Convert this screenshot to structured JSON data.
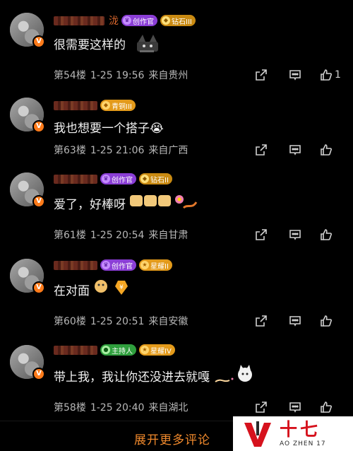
{
  "comments": [
    {
      "name_suffix": "泷",
      "badges": [
        {
          "label": "创作官",
          "icon": "creator-icon",
          "color": "#8b3ed6"
        },
        {
          "label": "钻石III",
          "icon": "diamond-icon",
          "color": "#c98a12"
        }
      ],
      "text": "很需要这样的",
      "sticker": "cat-sticker",
      "floor": "第54楼",
      "time": "1-25 19:56",
      "location": "来自贵州",
      "like_count": "1"
    },
    {
      "name_suffix": "",
      "badges": [
        {
          "label": "青铜III",
          "icon": "bronze-icon",
          "color": "#e39a1a"
        }
      ],
      "text": "我也想要一个搭子😭",
      "sticker": "",
      "floor": "第63楼",
      "time": "1-25 21:06",
      "location": "来自广西",
      "like_count": ""
    },
    {
      "name_suffix": "",
      "badges": [
        {
          "label": "创作官",
          "icon": "creator-icon",
          "color": "#8b3ed6"
        },
        {
          "label": "钻石II",
          "icon": "diamond-icon",
          "color": "#c98a12"
        }
      ],
      "text": "爱了，好棒呀",
      "sticker": "clap-flower-sticker",
      "floor": "第61楼",
      "time": "1-25 20:54",
      "location": "来自甘肃",
      "like_count": ""
    },
    {
      "name_suffix": "",
      "badges": [
        {
          "label": "创作官",
          "icon": "creator-icon",
          "color": "#8b3ed6"
        },
        {
          "label": "星耀II",
          "icon": "star-icon",
          "color": "#e39a1a"
        }
      ],
      "text": "在对面",
      "sticker": "doge-sticker",
      "floor": "第60楼",
      "time": "1-25 20:51",
      "location": "来自安徽",
      "like_count": ""
    },
    {
      "name_suffix": "",
      "badges": [
        {
          "label": "主持人",
          "icon": "host-icon",
          "color": "#2f9f3d"
        },
        {
          "label": "星耀IV",
          "icon": "star-icon",
          "color": "#e39a1a"
        }
      ],
      "text": "带上我，我让你还没进去就嘎",
      "sticker": "cat-sticker",
      "floor": "第58楼",
      "time": "1-25 20:40",
      "location": "来自湖北",
      "like_count": ""
    }
  ],
  "footer": {
    "more_label": "展开更多评论"
  },
  "watermark": {
    "title": "十七",
    "subtitle": "AO ZHEN 17",
    "brand_color": "#d6121d"
  },
  "colors": {
    "accent": "#f0892c",
    "verified": "#ff7b1a"
  }
}
